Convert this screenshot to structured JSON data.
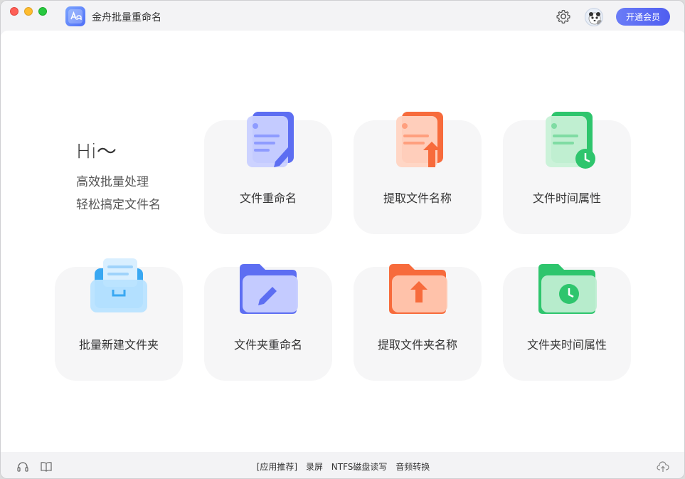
{
  "titlebar": {
    "app_name": "金舟批量重命名",
    "vip_label": "开通会员",
    "icons": [
      "gear-icon",
      "avatar"
    ]
  },
  "greeting": {
    "hi": "Hi～",
    "line1": "高效批量处理",
    "line2": "轻松搞定文件名"
  },
  "cards": [
    {
      "label": "文件重命名",
      "icon": "file-rename-icon",
      "color": "#6b7cf6"
    },
    {
      "label": "提取文件名称",
      "icon": "file-extract-icon",
      "color": "#f9784d"
    },
    {
      "label": "文件时间属性",
      "icon": "file-time-icon",
      "color": "#2fcf73"
    },
    {
      "label": "批量新建文件夹",
      "icon": "folder-new-icon",
      "color": "#3ab4f5"
    },
    {
      "label": "文件夹重命名",
      "icon": "folder-rename-icon",
      "color": "#6b7cf6"
    },
    {
      "label": "提取文件夹名称",
      "icon": "folder-extract-icon",
      "color": "#f9784d"
    },
    {
      "label": "文件夹时间属性",
      "icon": "folder-time-icon",
      "color": "#2fcf73"
    }
  ],
  "footer": {
    "recommend_label": "[应用推荐]",
    "links": [
      "录屏",
      "NTFS磁盘读写",
      "音频转换"
    ],
    "left_icons": [
      "headset-icon",
      "book-icon"
    ],
    "right_icon": "cloud-upload-icon"
  }
}
